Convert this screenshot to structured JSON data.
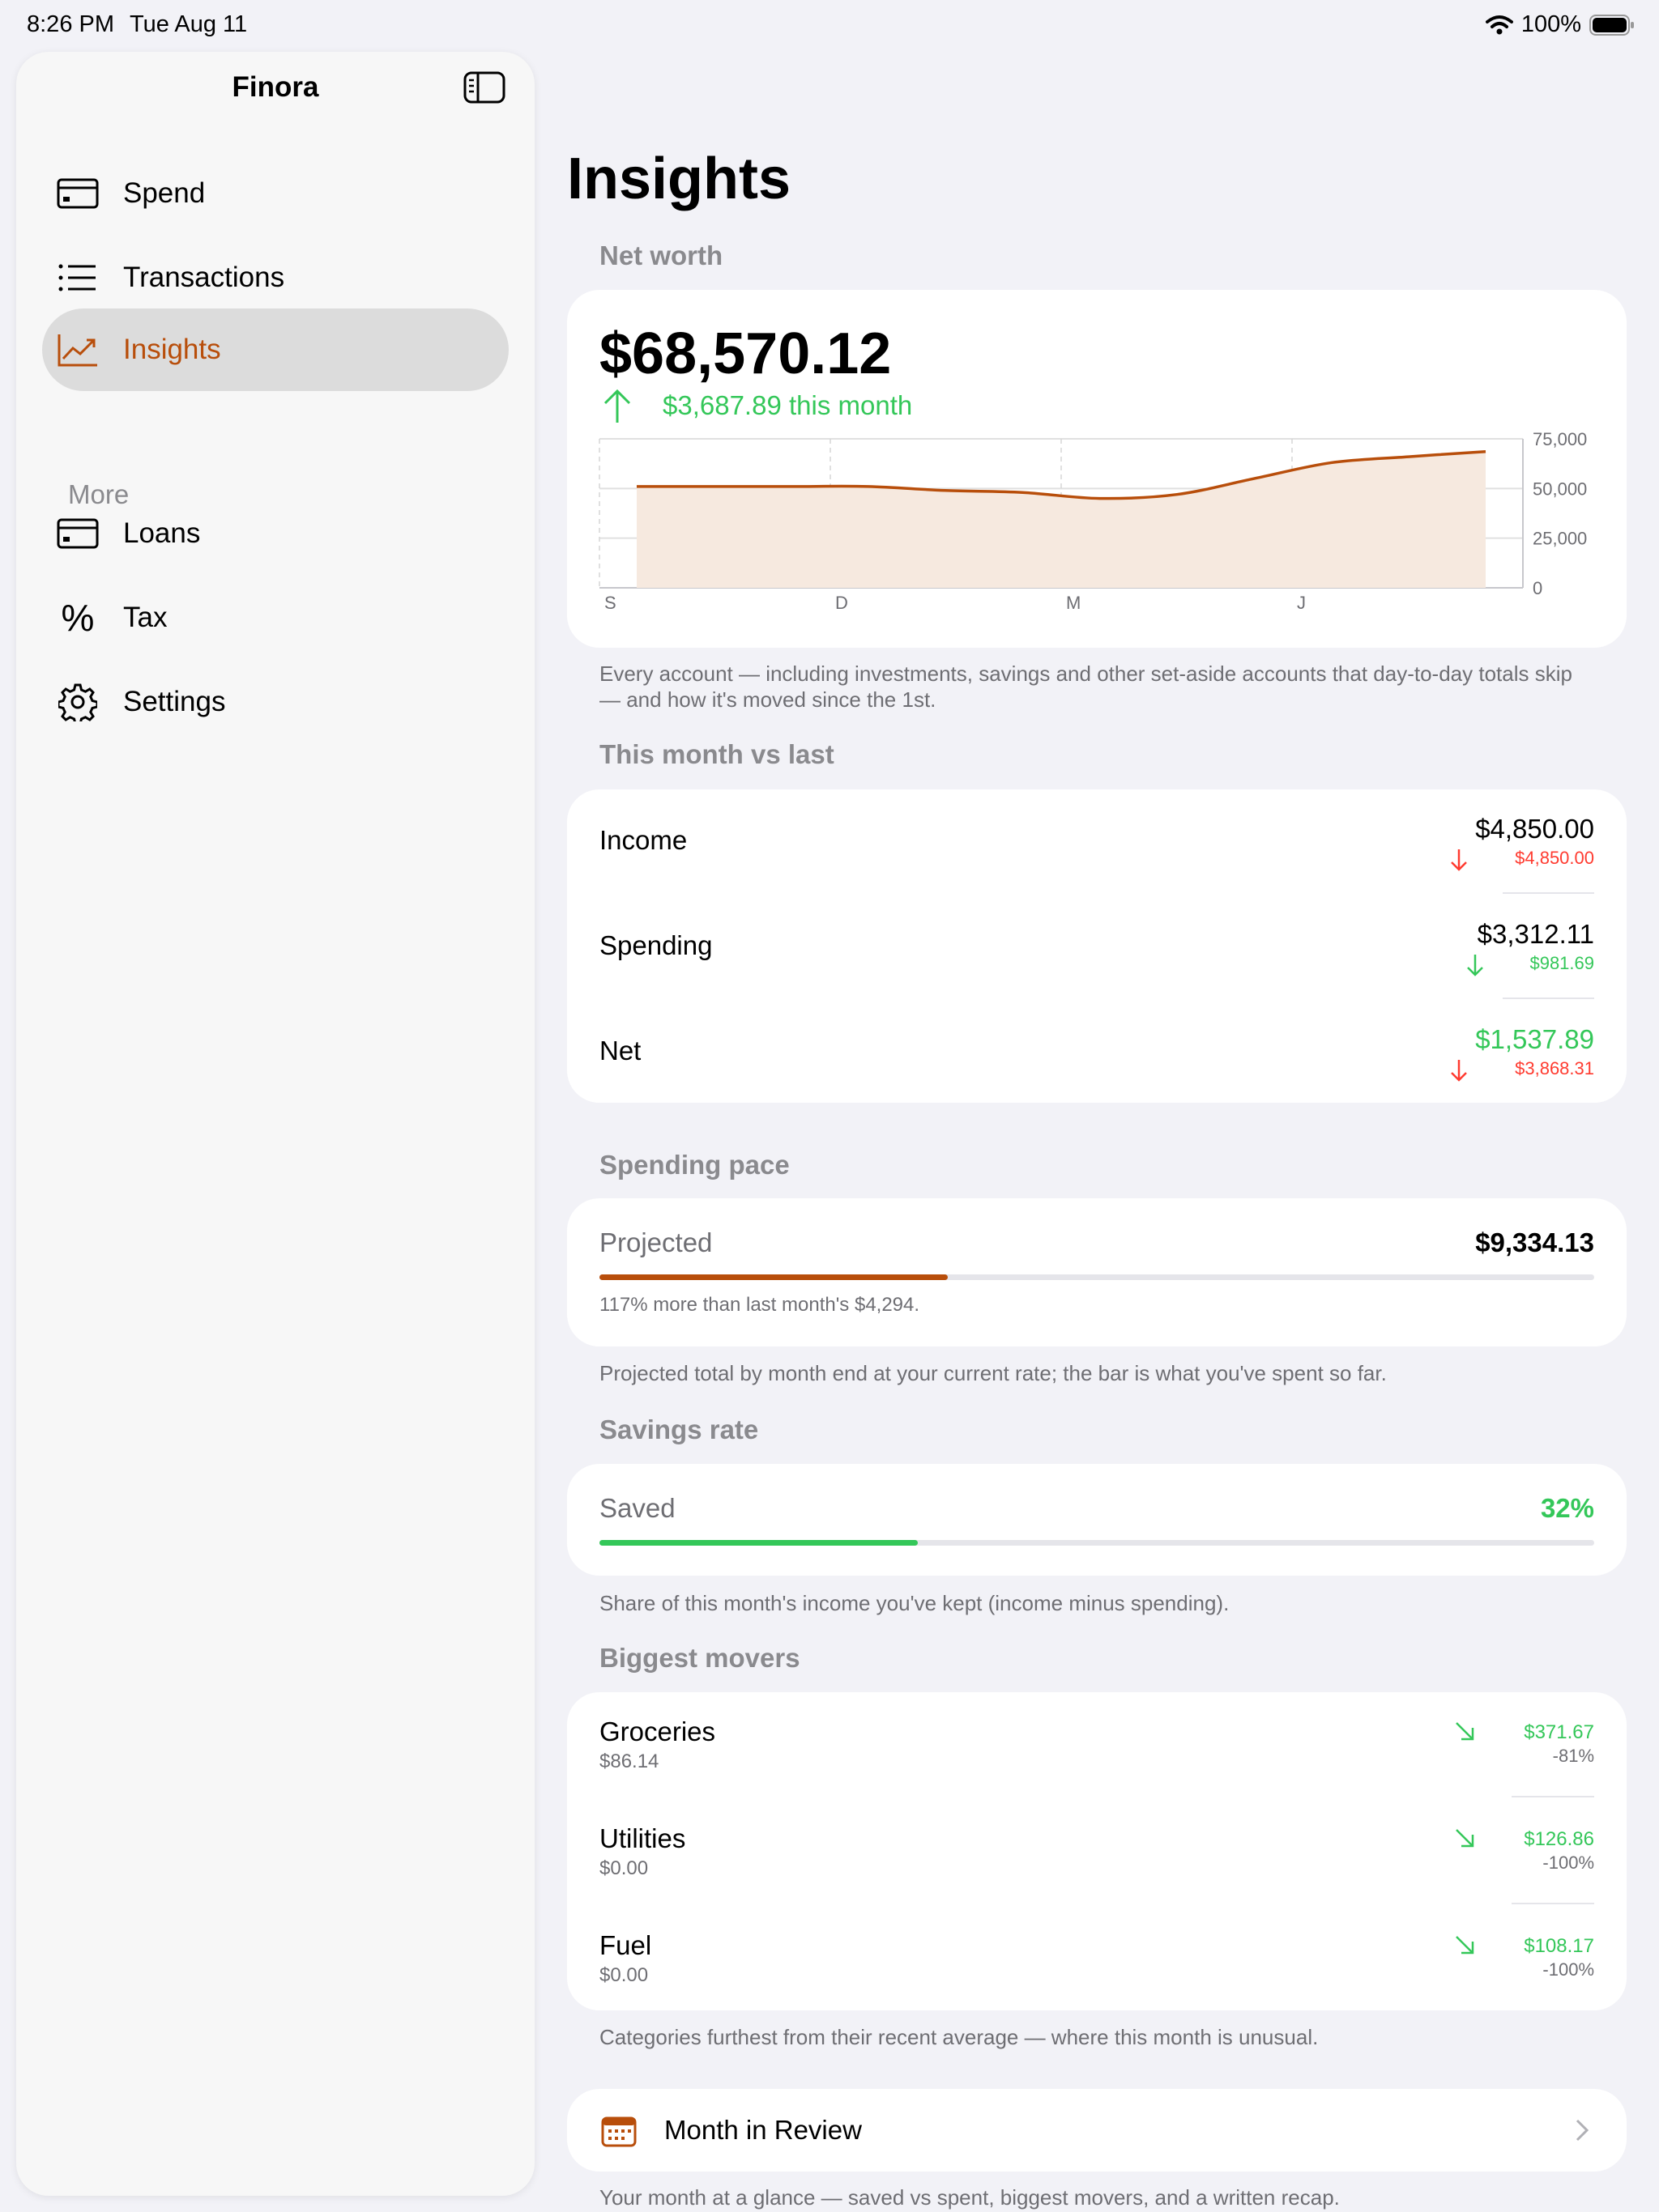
{
  "status_bar": {
    "time": "8:26 PM",
    "date": "Tue Aug 11",
    "battery": "100%"
  },
  "sidebar": {
    "title": "Finora",
    "items": [
      {
        "label": "Spend",
        "icon": "credit-card-icon",
        "active": false
      },
      {
        "label": "Transactions",
        "icon": "list-icon",
        "active": false
      },
      {
        "label": "Insights",
        "icon": "trend-chart-icon",
        "active": true
      }
    ],
    "section_label": "More",
    "more_items": [
      {
        "label": "Loans",
        "icon": "credit-card-icon"
      },
      {
        "label": "Tax",
        "icon": "percent-icon"
      },
      {
        "label": "Settings",
        "icon": "gear-icon"
      }
    ]
  },
  "page": {
    "title": "Insights"
  },
  "net_worth": {
    "heading": "Net worth",
    "value": "$68,570.12",
    "delta": "$3,687.89 this month",
    "footnote": "Every account — including investments, savings and other set-aside accounts that day-to-day totals skip — and how it's moved since the 1st."
  },
  "chart_data": {
    "type": "area",
    "x": [
      "S",
      "",
      "D",
      "",
      "M",
      "",
      "",
      "J",
      "",
      "",
      "",
      ""
    ],
    "x_tick_labels": [
      "S",
      "D",
      "M",
      "J"
    ],
    "y_tick_labels": [
      "75,000",
      "50,000",
      "25,000",
      "0"
    ],
    "ylim": [
      0,
      75000
    ],
    "series": [
      {
        "values": [
          51000,
          51000,
          51000,
          51000,
          49000,
          48000,
          45000,
          47000,
          55000,
          63000,
          66000,
          68570
        ]
      }
    ],
    "grid": true,
    "colors": {
      "line": "#b84e0b",
      "fill": "#f6e9df"
    }
  },
  "comparison": {
    "heading": "This month vs last",
    "rows": [
      {
        "label": "Income",
        "value": "$4,850.00",
        "delta": "$4,850.00",
        "direction": "down",
        "tone": "red",
        "value_tone": "black"
      },
      {
        "label": "Spending",
        "value": "$3,312.11",
        "delta": "$981.69",
        "direction": "down",
        "tone": "green",
        "value_tone": "black"
      },
      {
        "label": "Net",
        "value": "$1,537.89",
        "delta": "$3,868.31",
        "direction": "down",
        "tone": "red",
        "value_tone": "green"
      }
    ]
  },
  "spending_pace": {
    "heading": "Spending pace",
    "label": "Projected",
    "value": "$9,334.13",
    "progress": 0.35,
    "note": "117% more than last month's $4,294.",
    "footnote": "Projected total by month end at your current rate; the bar is what you've spent so far."
  },
  "savings_rate": {
    "heading": "Savings rate",
    "label": "Saved",
    "value": "32%",
    "progress": 0.32,
    "footnote": "Share of this month's income you've kept (income minus spending)."
  },
  "movers": {
    "heading": "Biggest movers",
    "items": [
      {
        "name": "Groceries",
        "previous": "$86.14",
        "amount": "$371.67",
        "percent": "-81%"
      },
      {
        "name": "Utilities",
        "previous": "$0.00",
        "amount": "$126.86",
        "percent": "-100%"
      },
      {
        "name": "Fuel",
        "previous": "$0.00",
        "amount": "$108.17",
        "percent": "-100%"
      }
    ],
    "footnote": "Categories furthest from their recent average — where this month is unusual."
  },
  "month_review": {
    "label": "Month in Review",
    "icon": "calendar-icon",
    "footnote": "Your month at a glance — saved vs spent, biggest movers, and a written recap."
  },
  "colors": {
    "accent": "#b84e0b",
    "positive": "#34c759",
    "negative": "#ff3b30"
  }
}
